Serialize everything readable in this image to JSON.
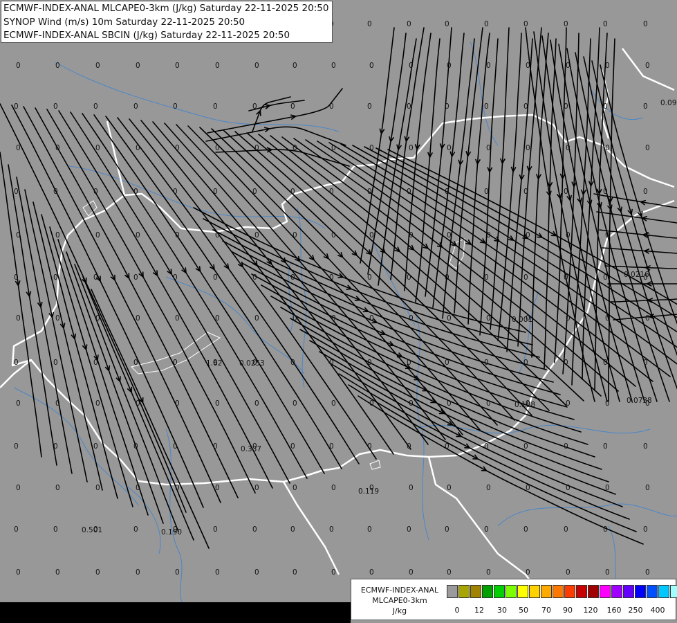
{
  "title_lines": [
    "ECMWF-INDEX-ANAL MLCAPE0-3km (J/kg) Saturday 22-11-2025 20:50",
    "SYNOP Wind (m/s) 10m Saturday 22-11-2025 20:50",
    "ECMWF-INDEX-ANAL SBCIN (J/kg) Saturday 22-11-2025 20:50"
  ],
  "legend": {
    "title_line1": "ECMWF-INDEX-ANAL",
    "title_line2": "MLCAPE0-3km",
    "unit": "J/kg",
    "colors": [
      "#9a9a9a",
      "#a8a400",
      "#a08400",
      "#00a000",
      "#00d000",
      "#7cff00",
      "#ffff00",
      "#ffd200",
      "#ffaa00",
      "#ff7800",
      "#ff3c00",
      "#c80000",
      "#a00000",
      "#ff00ff",
      "#a000ff",
      "#6400ff",
      "#0000ff",
      "#0050ff",
      "#00c8ff",
      "#a0ffff",
      "#ffffff"
    ],
    "tick_labels": [
      "0",
      "12",
      "30",
      "50",
      "70",
      "90",
      "120",
      "160",
      "250",
      "400"
    ]
  },
  "sbcin_labels": [
    "0",
    "0",
    "0",
    "0",
    "0",
    "0",
    "0",
    "0",
    "0",
    "0",
    "0",
    "0",
    "0",
    "0",
    "0",
    "0",
    "1.62",
    "0.0253",
    "0.337",
    "0.119",
    "0.001",
    "0.188",
    "0.0738",
    "0.0216",
    "0.09",
    "0.501",
    "0.190"
  ],
  "colors": {
    "background": "#989898",
    "borders": "#ffffff",
    "rivers": "#4a86c8",
    "streamlines": "#000000"
  }
}
